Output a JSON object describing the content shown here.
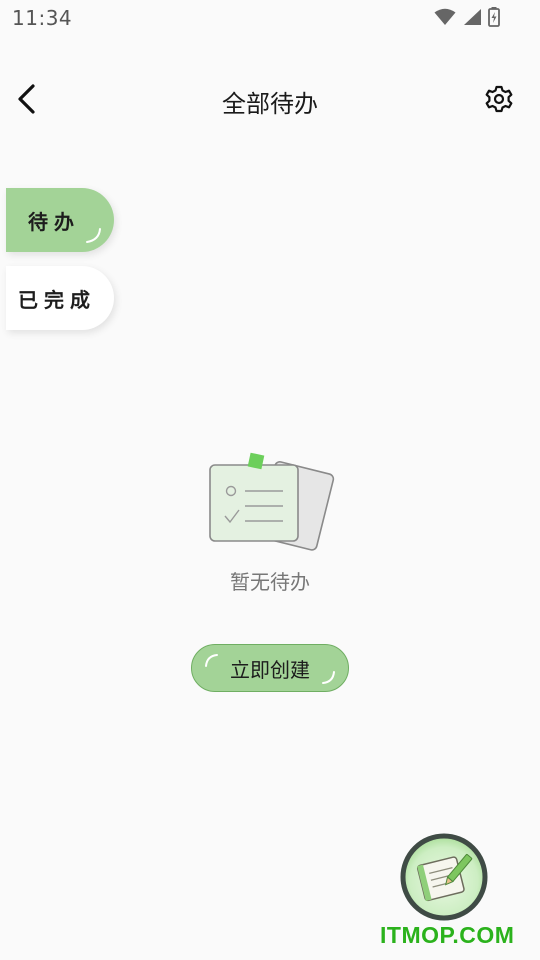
{
  "status_bar": {
    "time": "11:34",
    "icons": [
      "wifi-icon",
      "cell-signal-icon",
      "battery-charging-icon"
    ]
  },
  "header": {
    "title": "全部待办",
    "back_icon": "chevron-left-icon",
    "settings_icon": "gear-icon"
  },
  "side_tabs": [
    {
      "label": "待办",
      "selected": true
    },
    {
      "label": "已完成",
      "selected": false
    }
  ],
  "empty_state": {
    "illustration": "empty-notes-illustration",
    "message": "暂无待办"
  },
  "create_button": {
    "label": "立即创建"
  },
  "fab": {
    "icon": "notebook-pencil-icon"
  },
  "watermark": "ITMOP.COM",
  "colors": {
    "accent_green": "#a3d397",
    "accent_green_border": "#6fae62",
    "background": "#fafafa",
    "watermark_green": "#2bb21c"
  }
}
